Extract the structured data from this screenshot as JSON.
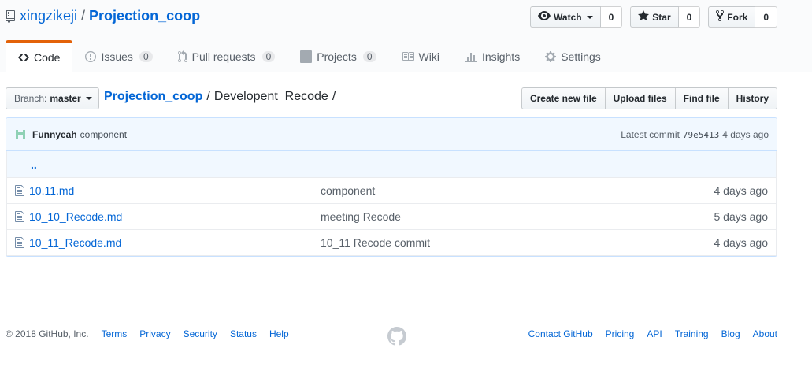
{
  "repo": {
    "owner": "xingzikeji",
    "separator": "/",
    "name": "Projection_coop"
  },
  "actions": {
    "watch": {
      "label": "Watch",
      "count": "0"
    },
    "star": {
      "label": "Star",
      "count": "0"
    },
    "fork": {
      "label": "Fork",
      "count": "0"
    }
  },
  "nav": {
    "code": {
      "label": "Code"
    },
    "issues": {
      "label": "Issues",
      "count": "0"
    },
    "pulls": {
      "label": "Pull requests",
      "count": "0"
    },
    "projects": {
      "label": "Projects",
      "count": "0"
    },
    "wiki": {
      "label": "Wiki"
    },
    "insights": {
      "label": "Insights"
    },
    "settings": {
      "label": "Settings"
    }
  },
  "filenav": {
    "branch_label": "Branch:",
    "branch_value": "master",
    "breadcrumb_root": "Projection_coop",
    "breadcrumb_sep": "/",
    "breadcrumb_dir": "Developent_Recode",
    "breadcrumb_trailing": "/",
    "create_file": "Create new file",
    "upload_files": "Upload files",
    "find_file": "Find file",
    "history": "History"
  },
  "commit": {
    "author": "Funnyeah",
    "message": "component",
    "latest_label": "Latest commit",
    "sha": "79e5413",
    "age": "4 days ago"
  },
  "files": {
    "up_link": "..",
    "rows": [
      {
        "name": "10.11.md",
        "message": "component",
        "age": "4 days ago"
      },
      {
        "name": "10_10_Recode.md",
        "message": "meeting Recode",
        "age": "5 days ago"
      },
      {
        "name": "10_11_Recode.md",
        "message": "10_11 Recode commit",
        "age": "4 days ago"
      }
    ]
  },
  "footer": {
    "copyright": "© 2018 GitHub, Inc.",
    "left_links": [
      "Terms",
      "Privacy",
      "Security",
      "Status",
      "Help"
    ],
    "right_links": [
      "Contact GitHub",
      "Pricing",
      "API",
      "Training",
      "Blog",
      "About"
    ]
  },
  "colors": {
    "link": "#0366d6",
    "selected_tab_border": "#e36209",
    "commit_tease_bg": "#f1f8ff"
  }
}
